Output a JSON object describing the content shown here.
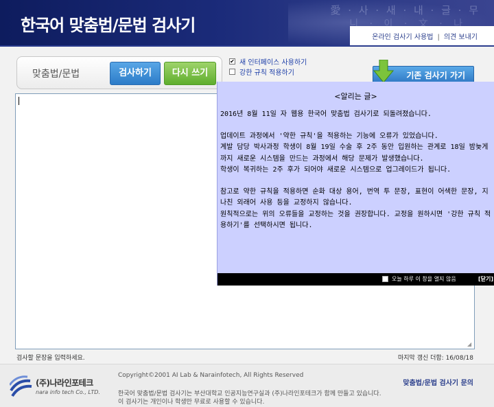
{
  "header": {
    "title": "한국어 맞춤법/문법 검사기",
    "links": [
      "온라인 검사기 사용법",
      "의견 보내기"
    ],
    "separator": "|"
  },
  "toolbar": {
    "label": "맞춤법/문법",
    "check_button": "검사하기",
    "reset_button": "다시 쓰기",
    "old_button": "기존 검사기 가기"
  },
  "options": [
    {
      "label": "새 인터페이스 사용하기",
      "checked": true
    },
    {
      "label": "강한 규칙 적용하기",
      "checked": false
    }
  ],
  "editor": {
    "hint": "검사할 문장을 입력하세요.",
    "last_updated": "마지막 갱신 더함: 16/08/18"
  },
  "notice": {
    "title": "<알리는 글>",
    "paragraphs": [
      "    2016년 8월 11일 자 웹용 한국어 맞춤법 검사기로 되돌려졌습니다.",
      "",
      "    업데이트 과정에서 '약한 규칙'을 적용하는 기능에 오류가 있었습니다.",
      "    계발 담당 박사과정 학생이 8월 19일 수술 후 2주 동안 입원하는 관계로 18일 밤늦게까지 새로운 시스템을 만드는 과정에서 해당 문제가 발생했습니다.",
      "    학생이 복귀하는 2주 후가 되어야 새로운 시스템으로 업그레이드가 됩니다.",
      "",
      "    참고로 약한 규칙을 적용하면 순화 대상 용어, 번역 투 문장, 표현이 어색한 문장, 지나친 외래어 사용 등을 교정하지 않습니다.",
      "    원칙적으로는 위의 오류들을 교정하는 것을 권장합니다. 교정을 원하시면 '강한 규칙 적용하기'를 선택하시면 됩니다."
    ],
    "dont_show": "오늘 하루 이 창을 열지 않음",
    "close": "[닫기]"
  },
  "footer": {
    "company": "(주)나라인포테크",
    "company_en": "nara info tech Co., LTD.",
    "copyright": "Copyright©2001 AI Lab & Narainfotech, All Rights Reserved",
    "about_1": "한국어 맞춤법/문법 검사기는 부산대학교 인공지능연구실과 (주)나라인포테크가 함께 만들고 있습니다.",
    "about_2": "이 검사기는 개인이나 학생만 무료로 사용할 수 있습니다.",
    "inquiry": "맞춤법/문법 검사기 문의"
  },
  "colors": {
    "header_bg": "#1b2b7a",
    "notice_bg": "#ccd0ff",
    "check_button": "#2c7cc8",
    "reset_button": "#5fae2e"
  }
}
